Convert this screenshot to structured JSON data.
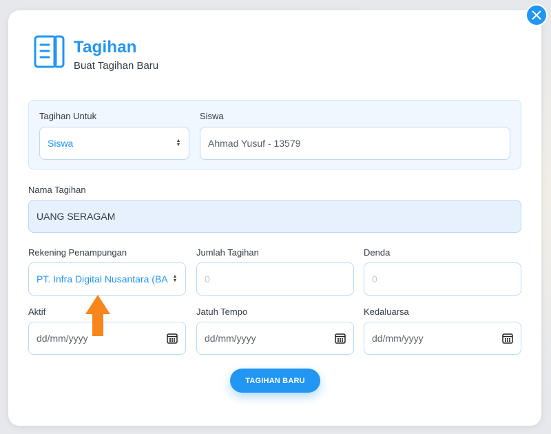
{
  "header": {
    "title": "Tagihan",
    "subtitle": "Buat Tagihan Baru",
    "icon": "ledger-book-icon"
  },
  "form": {
    "tagihan_untuk": {
      "label": "Tagihan Untuk",
      "value": "Siswa"
    },
    "siswa": {
      "label": "Siswa",
      "value": "Ahmad Yusuf - 13579"
    },
    "nama_tagihan": {
      "label": "Nama Tagihan",
      "value": "UANG SERAGAM"
    },
    "rekening": {
      "label": "Rekening Penampungan",
      "value": "PT. Infra Digital Nusantara (BA"
    },
    "jumlah": {
      "label": "Jumlah Tagihan",
      "placeholder": "0"
    },
    "denda": {
      "label": "Denda",
      "placeholder": "0"
    },
    "aktif": {
      "label": "Aktif",
      "placeholder": "dd/mm/yyyy"
    },
    "jatuh_tempo": {
      "label": "Jatuh Tempo",
      "placeholder": "dd/mm/yyyy"
    },
    "kedaluarsa": {
      "label": "Kedaluarsa",
      "placeholder": "dd/mm/yyyy"
    }
  },
  "actions": {
    "submit_label": "TAGIHAN BARU"
  },
  "colors": {
    "accent": "#2196f3",
    "annotation_arrow": "#f7861c",
    "panel_bg": "#f0f7ff",
    "field_border": "#b9daf7"
  }
}
